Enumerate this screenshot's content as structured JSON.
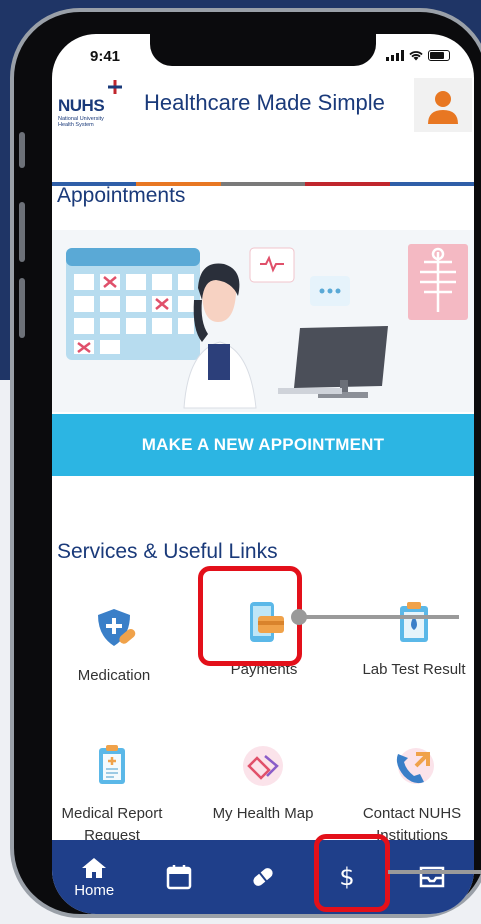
{
  "status": {
    "time": "9:41"
  },
  "header": {
    "logo_text": "NUHS",
    "logo_sub": "National University Health System",
    "title": "Healthcare Made Simple",
    "stripe_colors": [
      "#2f5fa8",
      "#e87722",
      "#7a7a7a",
      "#c0262d",
      "#2f5fa8"
    ]
  },
  "appointments": {
    "title": "Appointments",
    "cta_label": "MAKE A NEW APPOINTMENT"
  },
  "services": {
    "title": "Services & Useful Links",
    "items": [
      {
        "label": "Medication",
        "icon": "medication-shield-icon"
      },
      {
        "label": "Payments",
        "icon": "payment-card-icon"
      },
      {
        "label": "Lab Test Result",
        "icon": "lab-test-clipboard-icon"
      },
      {
        "label": "Medical Report Request",
        "icon": "medical-report-icon"
      },
      {
        "label": "My Health Map",
        "icon": "health-map-icon"
      },
      {
        "label": "Contact NUHS Institutions",
        "icon": "contact-phone-icon"
      }
    ]
  },
  "bottom_nav": {
    "items": [
      {
        "label": "Home",
        "icon": "home-icon"
      },
      {
        "label": "",
        "icon": "calendar-icon"
      },
      {
        "label": "",
        "icon": "pill-icon"
      },
      {
        "label": "",
        "icon": "dollar-icon"
      },
      {
        "label": "",
        "icon": "inbox-icon"
      }
    ]
  },
  "colors": {
    "brand_blue": "#1a3a7a",
    "cta_blue": "#2cb5e3",
    "nav_blue": "#1f3f8a",
    "highlight_red": "#e3101a"
  }
}
